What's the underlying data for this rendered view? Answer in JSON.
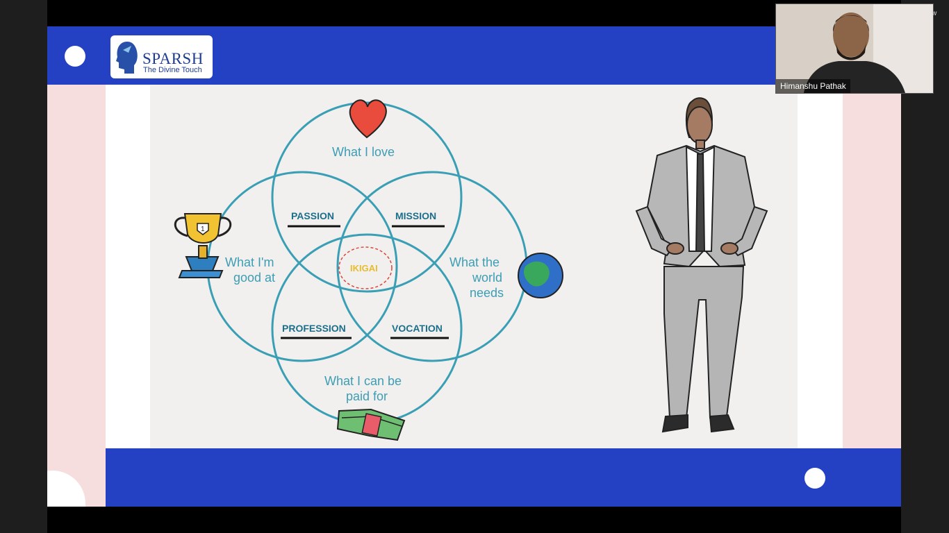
{
  "presentation": {
    "logo": {
      "name": "SPARSH",
      "tagline": "The Divine Touch"
    },
    "diagram": {
      "top_label": "What I love",
      "left_label_1": "What I'm",
      "left_label_2": "good at",
      "right_label_1": "What the",
      "right_label_2": "world",
      "right_label_3": "needs",
      "bottom_label_1": "What I can be",
      "bottom_label_2": "paid for",
      "passion": "PASSION",
      "mission": "MISSION",
      "profession": "PROFESSION",
      "vocation": "VOCATION",
      "center": "IKIGAI",
      "trophy_number": "1"
    },
    "colors": {
      "slide_blue": "#2441c4",
      "circle_teal": "#3a9fb5",
      "ikigai_gold": "#e8bd2d"
    }
  },
  "meeting": {
    "participant_name": "Himanshu Pathak",
    "corner_text": "w"
  }
}
